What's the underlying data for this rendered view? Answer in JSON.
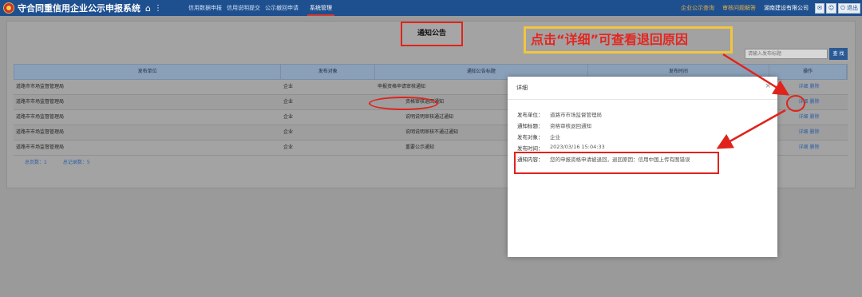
{
  "header": {
    "title": "守合同重信用企业公示申报系统",
    "nav": [
      "信用数据申报",
      "信用说明提交",
      "公示撤回申请",
      "系统管理"
    ],
    "right_links": [
      "企业公示查询",
      "审核问题解答"
    ],
    "user": "湖南建设有限公司",
    "logout": "退出"
  },
  "page": {
    "notice_title": "通知公告",
    "search_placeholder": "请输入发布标题",
    "search_button": "查 找"
  },
  "table": {
    "columns": [
      "发布单位",
      "发布对象",
      "通知公告标题",
      "发布时间",
      "操作"
    ],
    "rows": [
      {
        "unit": "道路市市场监督管理局",
        "target": "企业",
        "title": "申报资格申请审核通知",
        "time": ""
      },
      {
        "unit": "道路市市场监督管理局",
        "target": "企业",
        "title": "资格审核退回通知",
        "time": ""
      },
      {
        "unit": "道路市市场监督管理局",
        "target": "企业",
        "title": "说明说明审核通过通知",
        "time": ""
      },
      {
        "unit": "道路市市场监督管理局",
        "target": "企业",
        "title": "说明说明审核不通过通知",
        "time": ""
      },
      {
        "unit": "道路市市场监督管理局",
        "target": "企业",
        "title": "重要公示通知",
        "time": ""
      }
    ],
    "action_detail": "详细",
    "action_delete": "删除",
    "footer_pages": "总页数：1",
    "footer_records": "总记录数：5"
  },
  "callout": "点击“详细”可查看退回原因",
  "modal": {
    "title": "详细",
    "close": "×",
    "fields": [
      {
        "label": "发布单位：",
        "value": "道路市市场监督管理局"
      },
      {
        "label": "通知标题：",
        "value": "资格审核退回通知"
      },
      {
        "label": "发布对象：",
        "value": "企业"
      },
      {
        "label": "发布时间：",
        "value": "2023/03/16 15:04:33"
      },
      {
        "label": "通知内容：",
        "value": "您的申报资格申请被退回，退回原因：信用中国上传有图错误"
      }
    ]
  },
  "colors": {
    "header": "#1e4f8e",
    "highlight": "#e0231c",
    "callout_border": "#f2c53e"
  }
}
